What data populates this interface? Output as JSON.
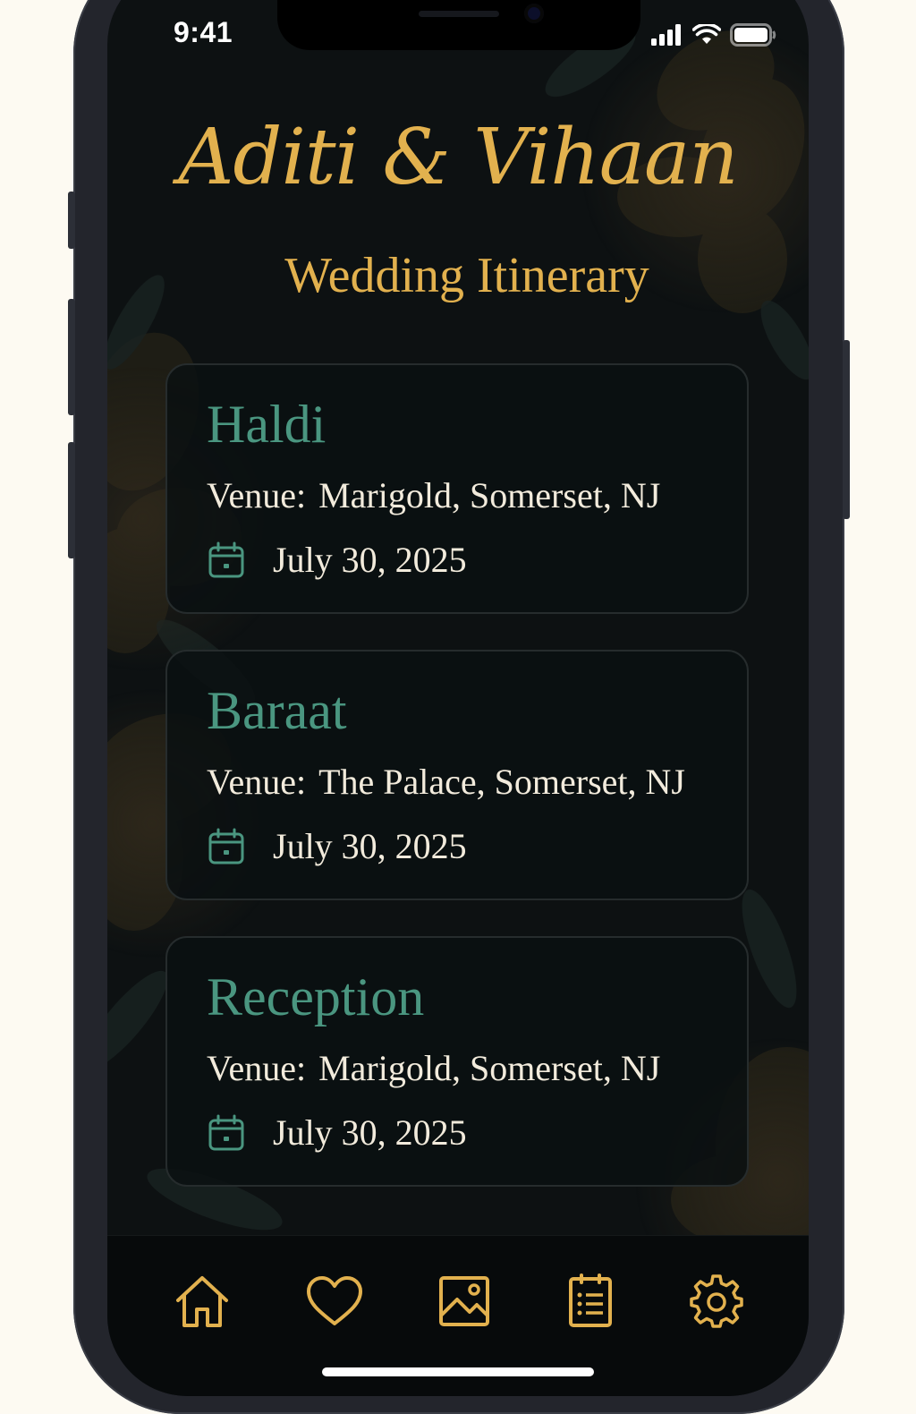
{
  "status_bar": {
    "time": "9:41"
  },
  "header": {
    "couple_names": "Aditi & Vihaan",
    "subtitle": "Wedding Itinerary"
  },
  "events": [
    {
      "title": "Haldi",
      "venue_label": "Venue:",
      "venue": "Marigold, Somerset, NJ",
      "date": "July 30, 2025"
    },
    {
      "title": "Baraat",
      "venue_label": "Venue:",
      "venue": "The Palace, Somerset, NJ",
      "date": "July 30, 2025"
    },
    {
      "title": "Reception",
      "venue_label": "Venue:",
      "venue": "Marigold, Somerset, NJ",
      "date": "July 30, 2025"
    }
  ],
  "tab_bar": {
    "items": [
      {
        "icon": "home-icon"
      },
      {
        "icon": "heart-icon"
      },
      {
        "icon": "image-icon"
      },
      {
        "icon": "itinerary-list-icon"
      },
      {
        "icon": "gear-icon"
      }
    ]
  },
  "colors": {
    "accent_gold": "#e2b14e",
    "event_title_green": "#4a9680",
    "card_text": "#f2ebdc",
    "screen_background": "#0d1112",
    "page_background": "#fdfaf2"
  }
}
